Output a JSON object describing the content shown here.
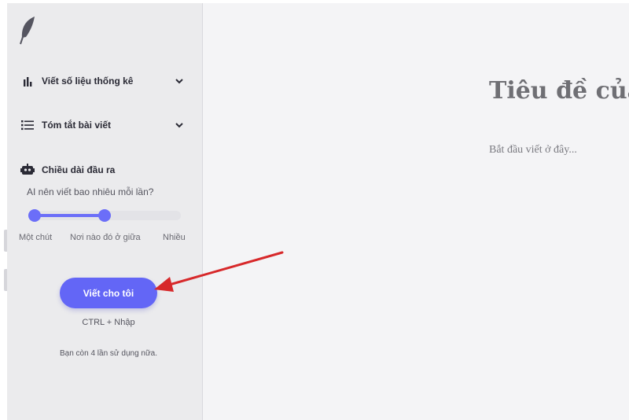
{
  "sidebar": {
    "sections": [
      {
        "label": "Viết số liệu thống kê",
        "icon": "bar-chart-icon"
      },
      {
        "label": "Tóm tắt bài viết",
        "icon": "list-icon"
      }
    ],
    "output_length": {
      "label": "Chiều dài đầu ra",
      "icon": "robot-icon",
      "question": "AI nên viết bao nhiêu mỗi lần?",
      "options": [
        "Một chút",
        "Nơi nào đó ở giữa",
        "Nhiều"
      ],
      "selected_range": [
        0,
        0.5
      ]
    },
    "write_button": "Viết cho tôi",
    "shortcut": "CTRL + Nhập",
    "remaining": "Bạn còn 4 lần sử dụng nữa."
  },
  "editor": {
    "title_placeholder": "Tiêu đề của",
    "body_placeholder": "Bắt đầu viết ở đây..."
  },
  "colors": {
    "accent": "#6366f6",
    "annotation_arrow": "#d7282a"
  }
}
